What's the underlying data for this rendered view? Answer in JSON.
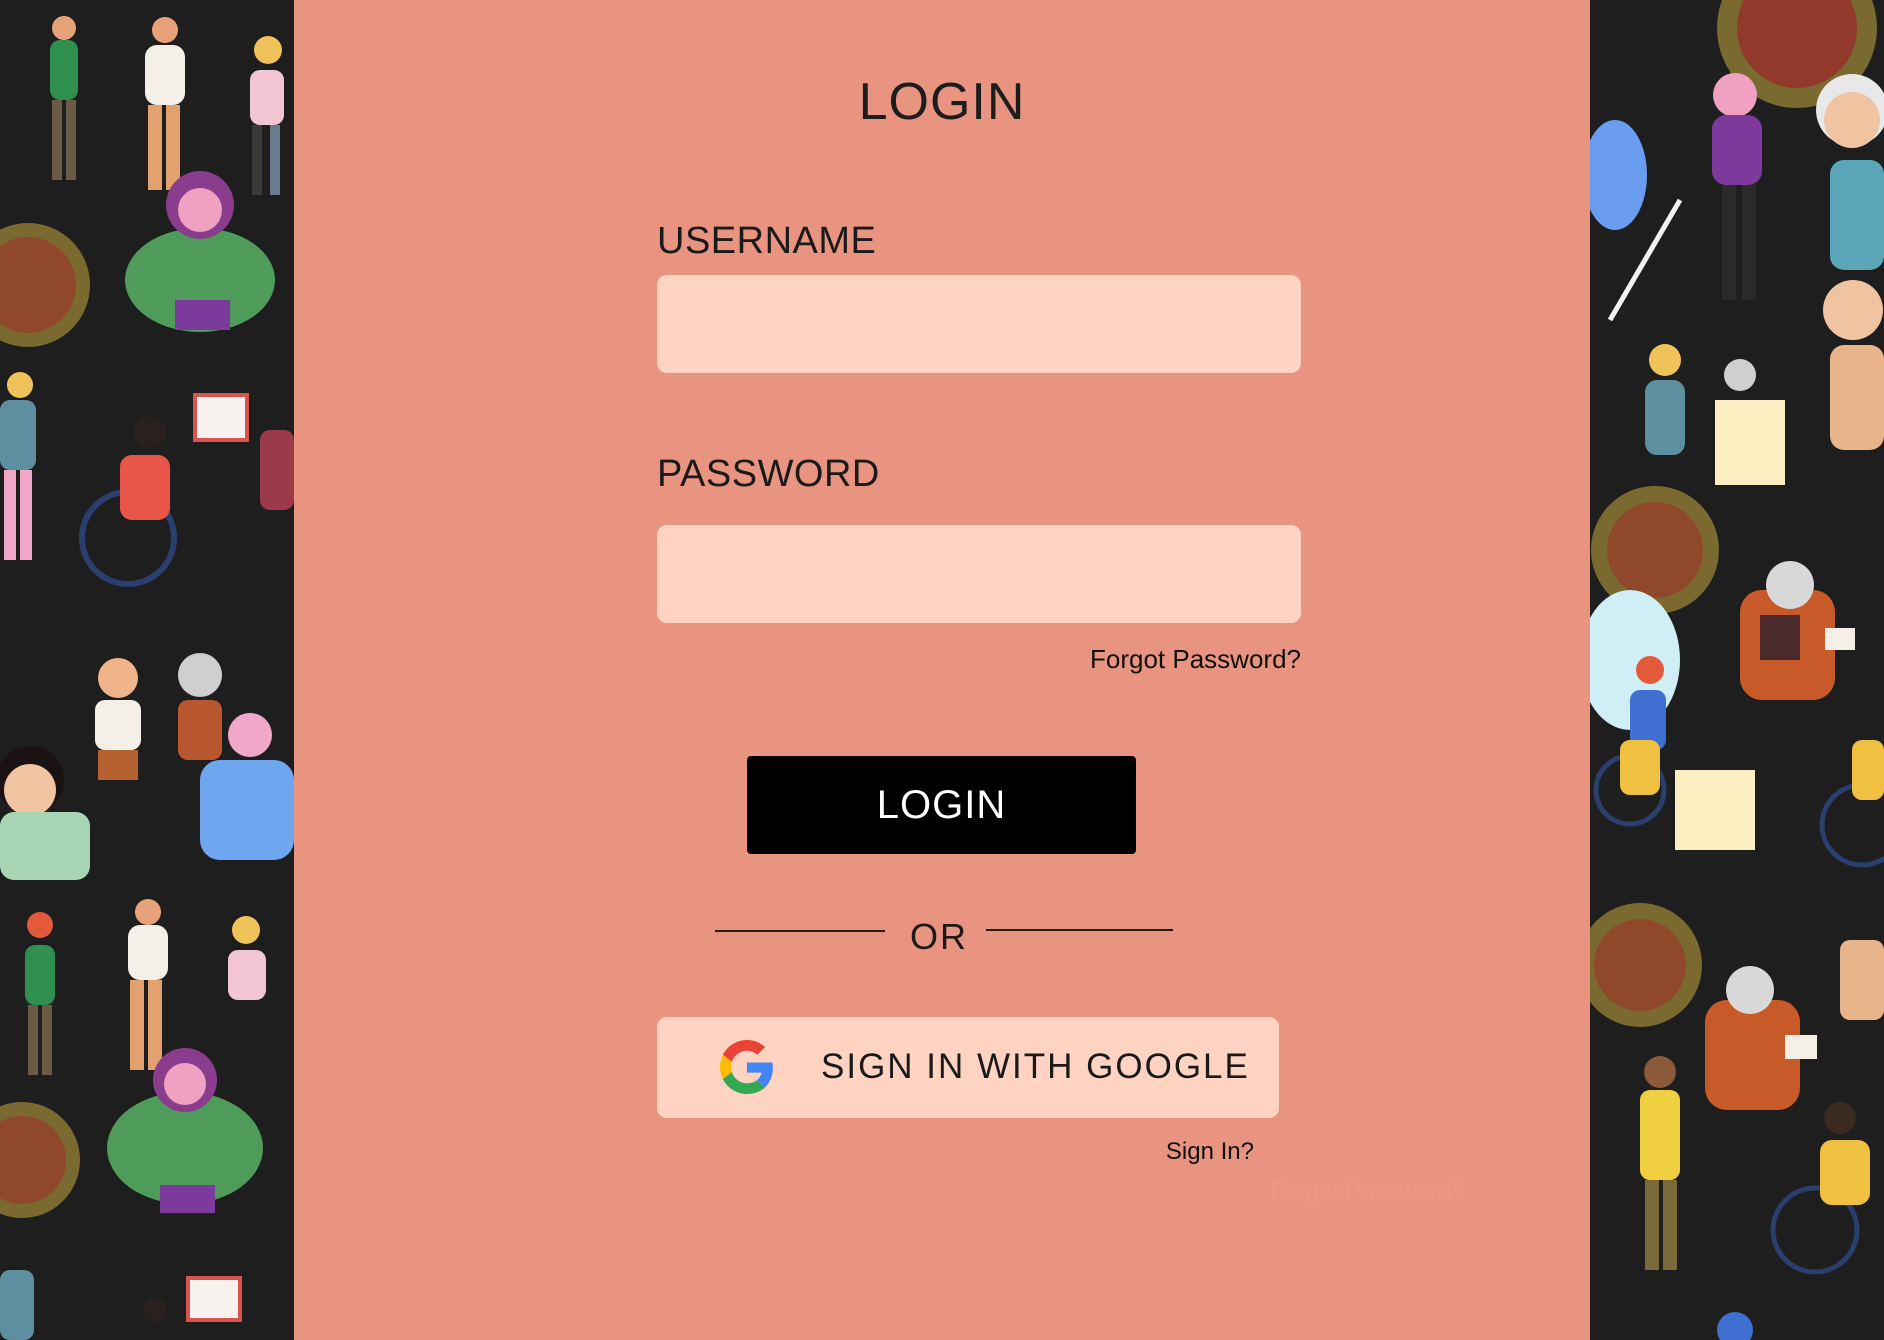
{
  "login_form": {
    "title": "LOGIN",
    "username_label": "USERNAME",
    "username_value": "",
    "password_label": "PASSWORD",
    "password_value": "",
    "forgot_password_link": "Forgot Password?",
    "login_button": "LOGIN",
    "divider_text": "OR",
    "google_button": "SIGN IN WITH GOOGLE",
    "sign_in_link": "Sign In?",
    "faded_forgot_password": "Forgot Password?"
  },
  "icons": {
    "google": "google-g-icon"
  },
  "colors": {
    "panel_background": "#e99481",
    "input_background": "#fed3c1",
    "login_button_background": "#000000",
    "side_background": "#1e1e1e"
  }
}
